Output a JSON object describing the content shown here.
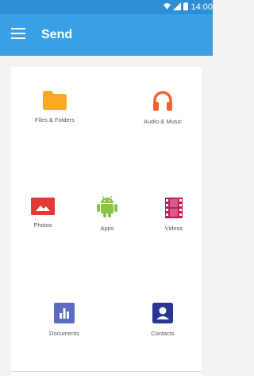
{
  "status_bar": {
    "time": "14:00",
    "icons": [
      "wifi-icon",
      "signal-icon",
      "battery-icon"
    ]
  },
  "app_bar": {
    "title": "Send",
    "menu_icon": "menu-icon",
    "colors": {
      "status": "#2f8fd6",
      "toolbar": "#3ba0e6"
    }
  },
  "categories": [
    {
      "label": "Files & Folders",
      "icon": "folder-icon",
      "color": "#f9a825"
    },
    {
      "label": "Audio & Music",
      "icon": "headphones-icon",
      "color": "#f2622e"
    },
    {
      "label": "Photos",
      "icon": "photo-icon",
      "color": "#e53935"
    },
    {
      "label": "Apps",
      "icon": "android-icon",
      "color": "#8bc34a"
    },
    {
      "label": "Videos",
      "icon": "film-icon",
      "color": "#c2185b"
    },
    {
      "label": "Documents",
      "icon": "chart-icon",
      "color": "#5c6bc0"
    },
    {
      "label": "Contacts",
      "icon": "contact-card-icon",
      "color": "#283593"
    }
  ]
}
